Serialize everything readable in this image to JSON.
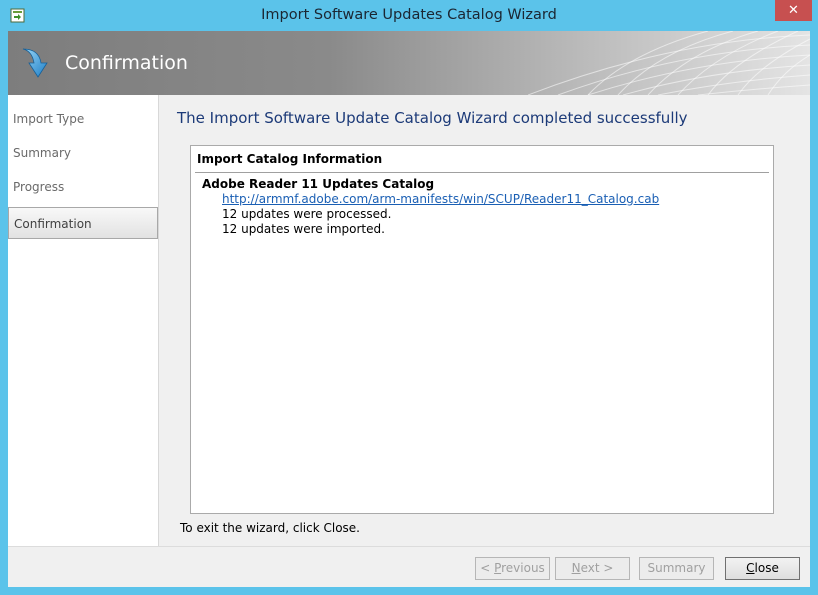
{
  "window": {
    "title": "Import Software Updates Catalog Wizard",
    "close_glyph": "✕"
  },
  "banner": {
    "title": "Confirmation"
  },
  "nav": {
    "items": [
      {
        "label": "Import Type"
      },
      {
        "label": "Summary"
      },
      {
        "label": "Progress"
      },
      {
        "label": "Confirmation"
      }
    ]
  },
  "main": {
    "heading": "The Import Software Update Catalog Wizard completed successfully",
    "panel": {
      "header": "Import Catalog Information",
      "catalog_name": "Adobe Reader 11 Updates Catalog",
      "catalog_url": "http://armmf.adobe.com/arm-manifests/win/SCUP/Reader11_Catalog.cab",
      "processed": "12 updates were processed.",
      "imported": "12 updates were imported."
    },
    "exit_text": "To exit the wizard, click Close."
  },
  "footer": {
    "previous_prefix": "< ",
    "previous_accel": "P",
    "previous_rest": "revious",
    "next_accel": "N",
    "next_rest": "ext >",
    "summary_label": "Summary",
    "close_accel": "C",
    "close_rest": "lose"
  },
  "colors": {
    "frame": "#5bc3ea",
    "heading": "#1c3a78",
    "link": "#1a5fb4",
    "close_button": "#c75050"
  }
}
